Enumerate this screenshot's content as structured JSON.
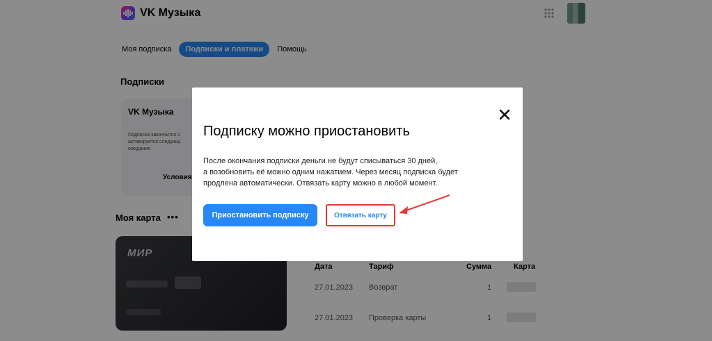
{
  "header": {
    "brand": "VK Музыка",
    "apps_icon": "grid-icon",
    "accent_color": "#2787f5"
  },
  "tabs": [
    {
      "label": "Моя подписка",
      "active": false
    },
    {
      "label": "Подписки и платежи",
      "active": true
    },
    {
      "label": "Помощь",
      "active": false
    }
  ],
  "subscriptions": {
    "heading": "Подписки",
    "card": {
      "title": "VK Музыка",
      "text": "Подписка закончится 2 активируется следующ ожидания.",
      "conditions": "Условия"
    }
  },
  "my_card": {
    "heading": "Моя карта",
    "menu": "•••",
    "brand": "МИР"
  },
  "payments_table": {
    "columns": [
      "Дата",
      "Тариф",
      "Сумма",
      "Карта"
    ],
    "rows": [
      {
        "date": "27.01.2023",
        "tariff": "Возврат",
        "amount": "1"
      },
      {
        "date": "27.01.2023",
        "tariff": "Проверка карты",
        "amount": "1"
      }
    ]
  },
  "modal": {
    "title": "Подписку можно приостановить",
    "text_line1": "После окончания подписки деньги не будут списываться 30 дней,",
    "text_line2": "а возобновить её можно одним нажатием. Через месяц подписка будет",
    "text_line3": "продлена автоматически. Отвязать карту можно в любой момент.",
    "primary_button": "Приостановить подписку",
    "secondary_button": "Отвязать карту",
    "close_icon": "close-icon",
    "highlight_color": "#e53935"
  }
}
